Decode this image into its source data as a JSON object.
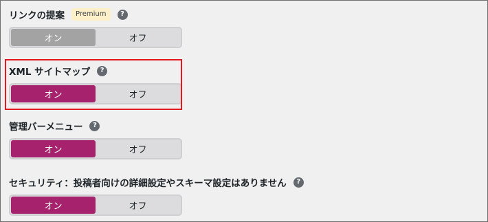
{
  "settings": [
    {
      "label": "リンクの提案",
      "badge": "Premium",
      "help": "?",
      "on_label": "オン",
      "off_label": "オフ",
      "state": "disabled"
    },
    {
      "label": "XML サイトマップ",
      "help": "?",
      "on_label": "オン",
      "off_label": "オフ",
      "state": "on"
    },
    {
      "label": "管理バーメニュー",
      "help": "?",
      "on_label": "オン",
      "off_label": "オフ",
      "state": "on"
    },
    {
      "label": "セキュリティ：投稿者向けの詳細設定やスキーマ設定はありません",
      "help": "?",
      "on_label": "オン",
      "off_label": "オフ",
      "state": "on"
    }
  ],
  "colors": {
    "accent": "#a7226c",
    "disabled": "#a3a3a3",
    "highlight": "#e3191f",
    "premium_badge": "#fdf0c9"
  }
}
